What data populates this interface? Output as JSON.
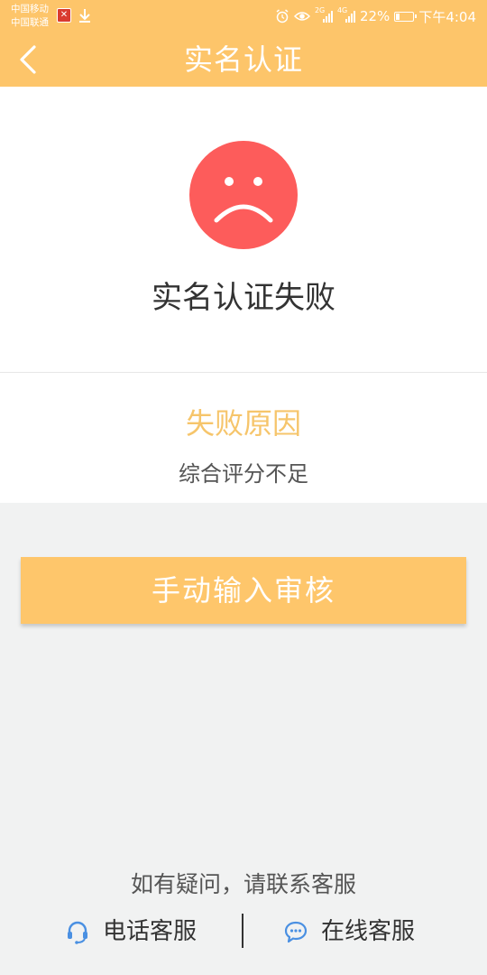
{
  "status_bar": {
    "carrier_1": "中国移动",
    "carrier_2": "中国联通",
    "sim1_network": "2G",
    "sim2_network": "4G",
    "battery_text": "22%",
    "battery_level": 0.22,
    "time": "下午4:04",
    "icons": [
      "app-notification-icon",
      "download-icon",
      "alarm-icon",
      "eye-icon",
      "signal-icon",
      "battery-icon"
    ]
  },
  "nav": {
    "title": "实名认证",
    "back_icon": "chevron-left-icon"
  },
  "result": {
    "icon": "sad-face-icon",
    "title": "实名认证失败"
  },
  "reason": {
    "heading": "失败原因",
    "text": "综合评分不足"
  },
  "actions": {
    "manual_review_label": "手动输入审核"
  },
  "help": {
    "prompt": "如有疑问，请联系客服",
    "phone_label": "电话客服",
    "online_label": "在线客服"
  },
  "colors": {
    "header_bg": "#fdc56a",
    "button_bg": "#fec66b",
    "sad_face": "#fd5c5b",
    "reason_heading": "#f6c56b",
    "contact_icon": "#4a90e2",
    "page_bg": "#f1f2f2"
  }
}
